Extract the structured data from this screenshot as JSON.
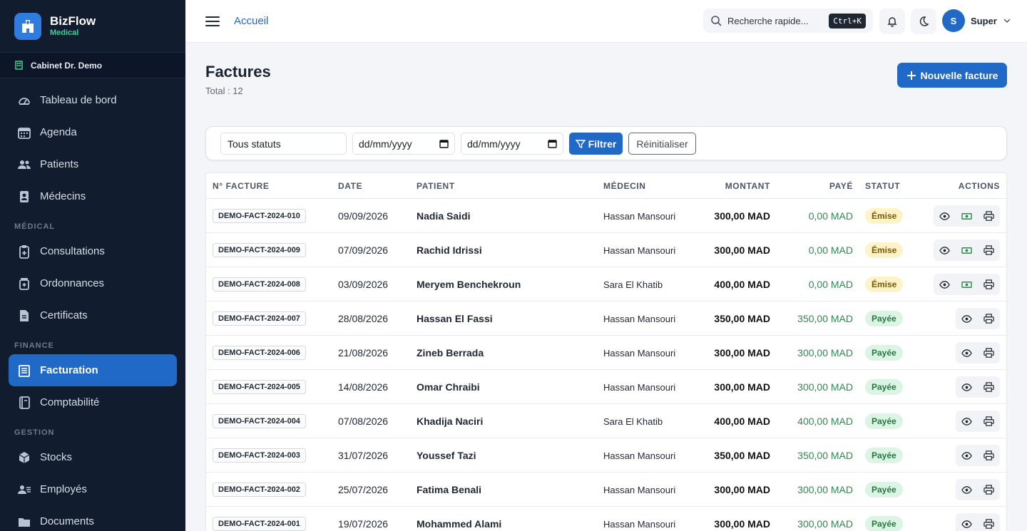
{
  "brand": {
    "name": "BizFlow",
    "sub": "Medical"
  },
  "clinic": "Cabinet Dr. Demo",
  "nav": {
    "main": [
      {
        "label": "Tableau de bord",
        "icon": "gauge-icon"
      },
      {
        "label": "Agenda",
        "icon": "calendar-icon"
      },
      {
        "label": "Patients",
        "icon": "users-icon"
      },
      {
        "label": "Médecins",
        "icon": "id-badge-icon"
      }
    ],
    "medical_title": "MÉDICAL",
    "medical": [
      {
        "label": "Consultations",
        "icon": "clipboard-icon"
      },
      {
        "label": "Ordonnances",
        "icon": "prescription-icon"
      },
      {
        "label": "Certificats",
        "icon": "document-icon"
      }
    ],
    "finance_title": "FINANCE",
    "finance": [
      {
        "label": "Facturation",
        "icon": "invoice-icon",
        "active": true
      },
      {
        "label": "Comptabilité",
        "icon": "ledger-icon"
      }
    ],
    "gestion_title": "GESTION",
    "gestion": [
      {
        "label": "Stocks",
        "icon": "box-icon"
      },
      {
        "label": "Employés",
        "icon": "employees-icon"
      },
      {
        "label": "Documents",
        "icon": "folder-icon"
      }
    ]
  },
  "topbar": {
    "breadcrumb": "Accueil",
    "search_placeholder": "Recherche rapide...",
    "shortcut": "Ctrl+K",
    "user_initial": "S",
    "user_name": "Super"
  },
  "page": {
    "title": "Factures",
    "subtitle": "Total : 12",
    "new_button": "Nouvelle facture"
  },
  "filters": {
    "status": "Tous statuts",
    "date_from": "dd/mm/yyyy",
    "date_to": "dd/mm/yyyy",
    "filter_button": "Filtrer",
    "reset_button": "Réinitialiser"
  },
  "table": {
    "headers": {
      "invoice": "N° FACTURE",
      "date": "DATE",
      "patient": "PATIENT",
      "doctor": "MÉDECIN",
      "amount": "MONTANT",
      "paid": "PAYÉ",
      "status": "STATUT",
      "actions": "ACTIONS"
    },
    "rows": [
      {
        "invoice": "DEMO-FACT-2024-010",
        "date": "09/09/2026",
        "patient": "Nadia Saidi",
        "doctor": "Hassan Mansouri",
        "amount": "300,00 MAD",
        "paid": "0,00 MAD",
        "status": "Émise",
        "status_key": "emise"
      },
      {
        "invoice": "DEMO-FACT-2024-009",
        "date": "07/09/2026",
        "patient": "Rachid Idrissi",
        "doctor": "Hassan Mansouri",
        "amount": "300,00 MAD",
        "paid": "0,00 MAD",
        "status": "Émise",
        "status_key": "emise"
      },
      {
        "invoice": "DEMO-FACT-2024-008",
        "date": "03/09/2026",
        "patient": "Meryem Benchekroun",
        "doctor": "Sara El Khatib",
        "amount": "400,00 MAD",
        "paid": "0,00 MAD",
        "status": "Émise",
        "status_key": "emise"
      },
      {
        "invoice": "DEMO-FACT-2024-007",
        "date": "28/08/2026",
        "patient": "Hassan El Fassi",
        "doctor": "Hassan Mansouri",
        "amount": "350,00 MAD",
        "paid": "350,00 MAD",
        "status": "Payée",
        "status_key": "payee"
      },
      {
        "invoice": "DEMO-FACT-2024-006",
        "date": "21/08/2026",
        "patient": "Zineb Berrada",
        "doctor": "Hassan Mansouri",
        "amount": "300,00 MAD",
        "paid": "300,00 MAD",
        "status": "Payée",
        "status_key": "payee"
      },
      {
        "invoice": "DEMO-FACT-2024-005",
        "date": "14/08/2026",
        "patient": "Omar Chraibi",
        "doctor": "Hassan Mansouri",
        "amount": "300,00 MAD",
        "paid": "300,00 MAD",
        "status": "Payée",
        "status_key": "payee"
      },
      {
        "invoice": "DEMO-FACT-2024-004",
        "date": "07/08/2026",
        "patient": "Khadija Naciri",
        "doctor": "Sara El Khatib",
        "amount": "400,00 MAD",
        "paid": "400,00 MAD",
        "status": "Payée",
        "status_key": "payee"
      },
      {
        "invoice": "DEMO-FACT-2024-003",
        "date": "31/07/2026",
        "patient": "Youssef Tazi",
        "doctor": "Hassan Mansouri",
        "amount": "350,00 MAD",
        "paid": "350,00 MAD",
        "status": "Payée",
        "status_key": "payee"
      },
      {
        "invoice": "DEMO-FACT-2024-002",
        "date": "25/07/2026",
        "patient": "Fatima Benali",
        "doctor": "Hassan Mansouri",
        "amount": "300,00 MAD",
        "paid": "300,00 MAD",
        "status": "Payée",
        "status_key": "payee"
      },
      {
        "invoice": "DEMO-FACT-2024-001",
        "date": "19/07/2026",
        "patient": "Mohammed Alami",
        "doctor": "Hassan Mansouri",
        "amount": "300,00 MAD",
        "paid": "300,00 MAD",
        "status": "Payée",
        "status_key": "payee"
      }
    ]
  },
  "colors": {
    "primary": "#2069c7",
    "sidebar": "#111c2e",
    "paid_green": "#2f8a4f"
  }
}
